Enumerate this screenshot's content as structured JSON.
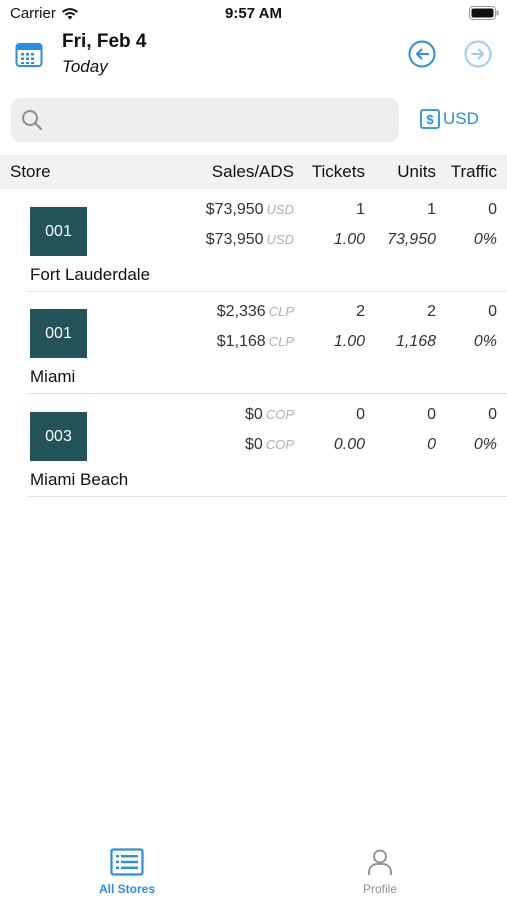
{
  "status_bar": {
    "carrier": "Carrier",
    "time": "9:57 AM"
  },
  "header": {
    "date": "Fri, Feb 4",
    "subtitle": "Today"
  },
  "search": {
    "placeholder": ""
  },
  "currency": {
    "label": "USD",
    "icon": "dollar-bill-icon"
  },
  "columns": {
    "store": "Store",
    "sales": "Sales/ADS",
    "tickets": "Tickets",
    "units": "Units",
    "traffic": "Traffic"
  },
  "stores": [
    {
      "code": "001",
      "name": "Fort Lauderdale",
      "sales": "$73,950",
      "sales_cur": "USD",
      "ads": "$73,950",
      "ads_cur": "USD",
      "tickets": "1",
      "tickets_ratio": "1.00",
      "units": "1",
      "units_ratio": "73,950",
      "traffic": "0",
      "traffic_pct": "0%"
    },
    {
      "code": "001",
      "name": "Miami",
      "sales": "$2,336",
      "sales_cur": "CLP",
      "ads": "$1,168",
      "ads_cur": "CLP",
      "tickets": "2",
      "tickets_ratio": "1.00",
      "units": "2",
      "units_ratio": "1,168",
      "traffic": "0",
      "traffic_pct": "0%"
    },
    {
      "code": "003",
      "name": "Miami Beach",
      "sales": "$0",
      "sales_cur": "COP",
      "ads": "$0",
      "ads_cur": "COP",
      "tickets": "0",
      "tickets_ratio": "0.00",
      "units": "0",
      "units_ratio": "0",
      "traffic": "0",
      "traffic_pct": "0%"
    }
  ],
  "tabs": [
    {
      "label": "All Stores",
      "icon": "stores-list-icon",
      "active": true
    },
    {
      "label": "Profile",
      "icon": "person-icon",
      "active": false
    }
  ],
  "colors": {
    "accent": "#2a8de3",
    "badge": "#225359",
    "header_bg": "#f2f2f4"
  }
}
